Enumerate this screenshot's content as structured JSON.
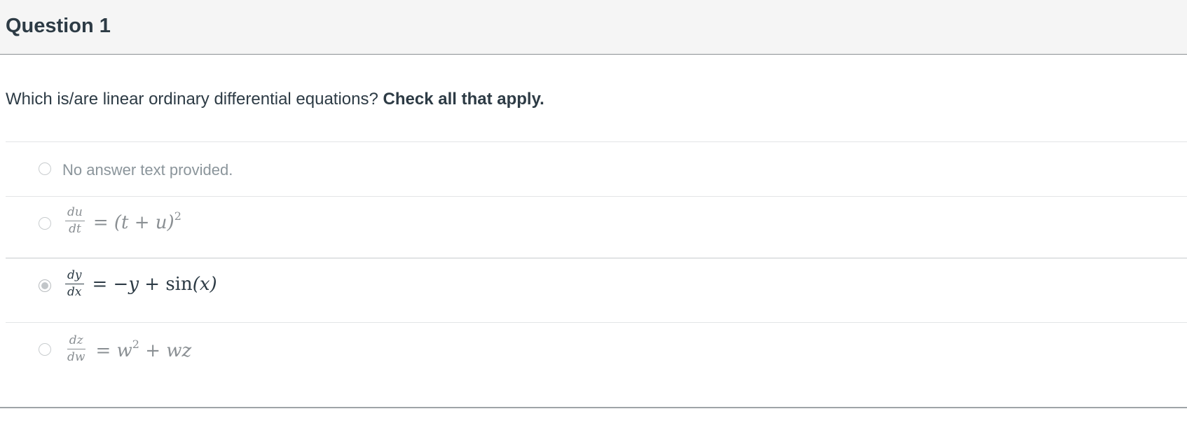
{
  "question": {
    "title": "Question 1",
    "prompt": "Which is/are linear ordinary differential equations?",
    "instruction": "Check all that apply."
  },
  "answers": [
    {
      "text": "No answer text provided.",
      "selected": false
    },
    {
      "frac_num": "du",
      "frac_den": "dt",
      "rhs_pre": "= (t + u)",
      "rhs_sup": "2",
      "rhs_post": "",
      "selected": false
    },
    {
      "frac_num": "dy",
      "frac_den": "dx",
      "rhs_pre": "= −y + ",
      "rhs_fn": "sin",
      "rhs_post": "(x)",
      "selected": true
    },
    {
      "frac_num": "dz",
      "frac_den": "dw",
      "rhs_pre": "= w",
      "rhs_sup": "2",
      "rhs_post": " + wz",
      "selected": false
    }
  ]
}
